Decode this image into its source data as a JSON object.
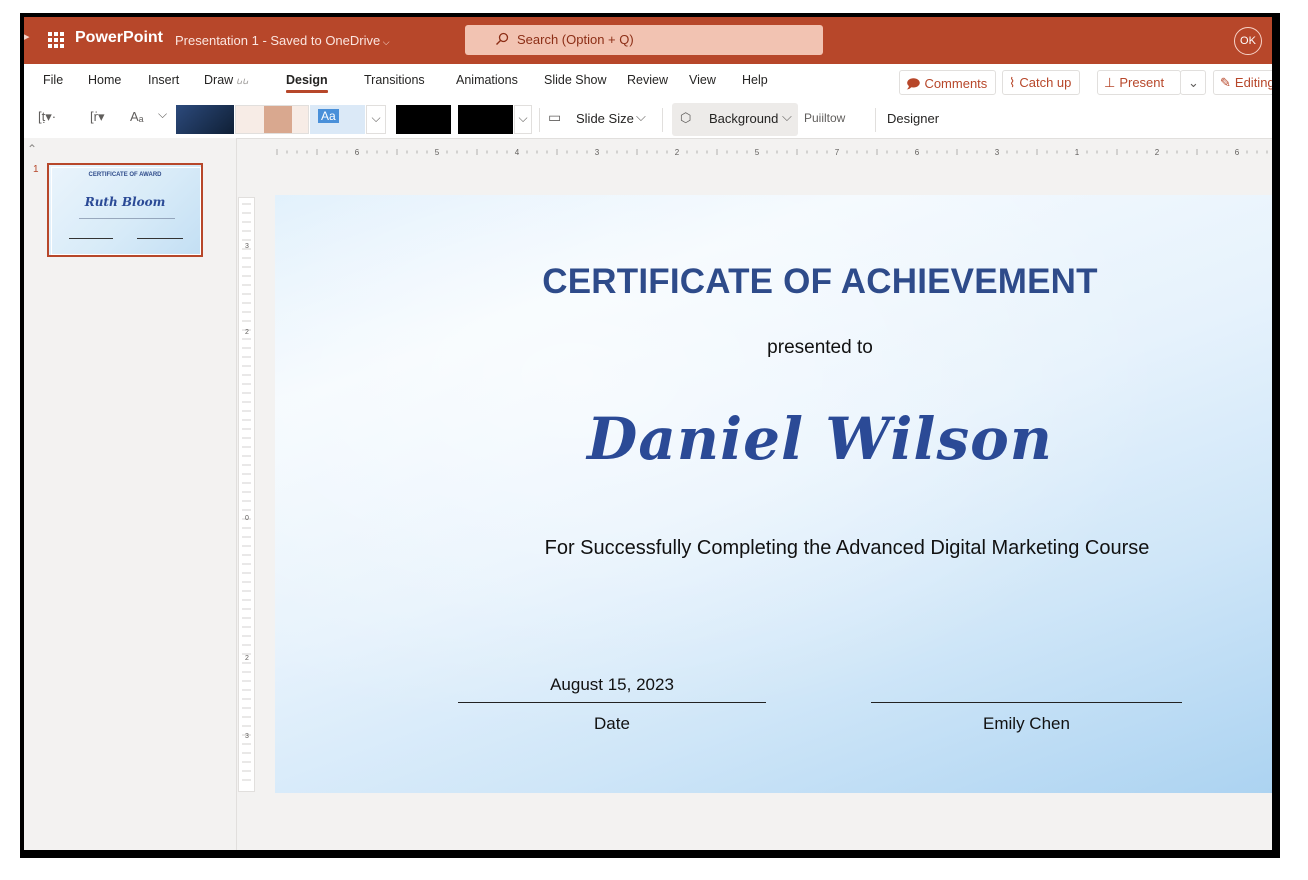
{
  "titlebar": {
    "app_name": "PowerPoint",
    "doc_status": "Presentation 1  -  Saved to OneDrive",
    "search_placeholder": "Search (Option + Q)",
    "account_initials": "OK",
    "accent_color": "#b7472a"
  },
  "menu": {
    "items": [
      "File",
      "Home",
      "Insert",
      "Draw",
      "Design",
      "Transitions",
      "Animations",
      "Slide Show",
      "Review",
      "View",
      "Help"
    ],
    "active": "Design"
  },
  "actions": {
    "comments": "Comments",
    "catch_up": "Catch up",
    "present": "Present",
    "editing": "Editing"
  },
  "ribbon": {
    "slide_size": "Slide Size",
    "background": "Background",
    "format": "Puiiltow",
    "designer": "Designer",
    "theme_sample": "Aa"
  },
  "thumbnail": {
    "number": "1",
    "title": "CERTIFICATE OF AWARD",
    "name": "Ruth Bloom"
  },
  "ruler": {
    "numbers": [
      "6",
      "5",
      "4",
      "3",
      "2",
      "5",
      "7",
      "6",
      "3",
      "1",
      "2",
      "6",
      "4"
    ],
    "v_numbers": [
      "3",
      "2",
      "0",
      "2",
      "3"
    ]
  },
  "slide": {
    "title": "CERTIFICATE OF ACHIEVEMENT",
    "presented": "presented to",
    "recipient": "Daniel Wilson",
    "description": "For Successfully Completing the Advanced Digital Marketing Course",
    "date_value": "August 15, 2023",
    "date_label": "Date",
    "signer": "Emily Chen",
    "title_color": "#2e4b8a",
    "name_color": "#2b4a96"
  }
}
